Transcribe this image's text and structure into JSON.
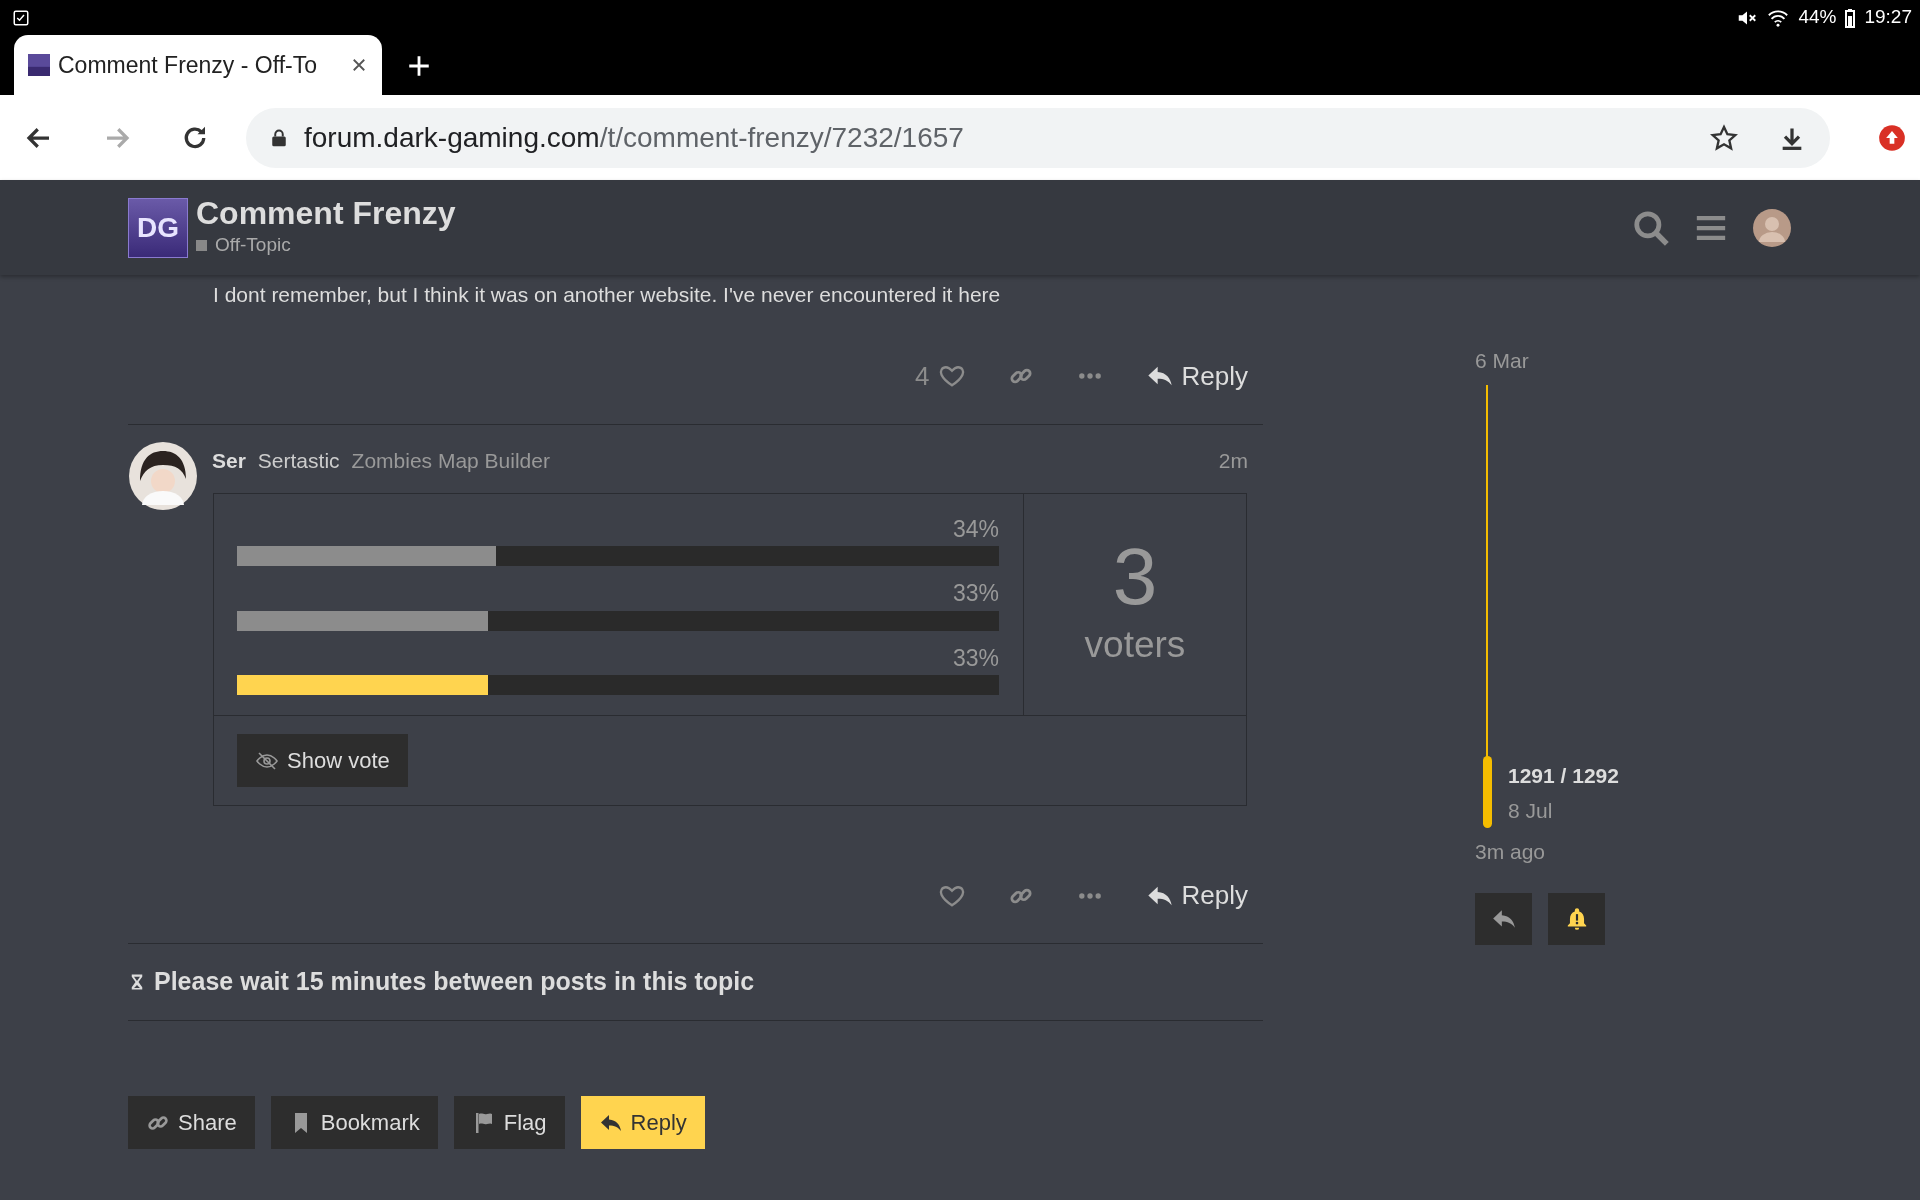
{
  "status_bar": {
    "battery": "44%",
    "time": "19:27"
  },
  "browser": {
    "tab": {
      "title": "Comment Frenzy - Off-To",
      "selected": true
    },
    "address": {
      "domain": "forum.dark-gaming.com",
      "path": "/t/comment-frenzy/7232/1657"
    }
  },
  "header": {
    "logo": "DG",
    "title": "Comment Frenzy",
    "category": "Off-Topic"
  },
  "previous_post": {
    "text": "I dont remember, but I think it was on another website. I've never encountered it here",
    "likes": "4",
    "reply": "Reply"
  },
  "post": {
    "username": "Ser",
    "name": "Sertastic",
    "user_title": "Zombies Map Builder",
    "time": "2m",
    "poll": {
      "options": [
        {
          "percent": "34%",
          "level": 0.34,
          "selected": false
        },
        {
          "percent": "33%",
          "level": 0.33,
          "selected": false
        },
        {
          "percent": "33%",
          "level": 0.33,
          "selected": true
        }
      ],
      "voters": "3",
      "voters_label": "voters",
      "button": "Show vote"
    },
    "reply": "Reply"
  },
  "notice": "Please wait 15 minutes between posts in this topic",
  "timeline": {
    "start": "6 Mar",
    "position": "1291 / 1292",
    "date": "8 Jul",
    "end": "3m ago"
  },
  "footer_buttons": [
    {
      "label": "Share",
      "kind": "share",
      "primary": false
    },
    {
      "label": "Bookmark",
      "kind": "bookmark",
      "primary": false
    },
    {
      "label": "Flag",
      "kind": "flag",
      "primary": false
    },
    {
      "label": "Reply",
      "kind": "reply",
      "primary": true
    }
  ]
}
